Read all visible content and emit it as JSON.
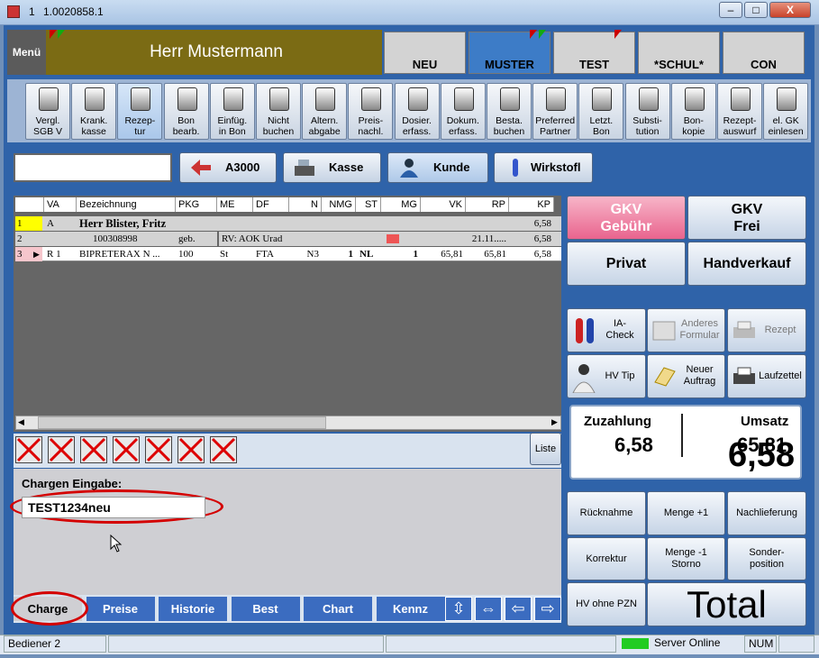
{
  "window": {
    "title_number": "1",
    "title": "1.0020858.1",
    "min": "–",
    "max": "□",
    "close": "X"
  },
  "header": {
    "menu": "Menü",
    "customer": "Herr Mustermann"
  },
  "customer_tabs": [
    "NEU",
    "MUSTER",
    "TEST",
    "*SCHUL*",
    "CON"
  ],
  "toolbar": [
    {
      "l1": "Vergl.",
      "l2": "SGB V"
    },
    {
      "l1": "Krank.",
      "l2": "kasse"
    },
    {
      "l1": "Rezep-",
      "l2": "tur"
    },
    {
      "l1": "Bon",
      "l2": "bearb."
    },
    {
      "l1": "Einfüg.",
      "l2": "in Bon"
    },
    {
      "l1": "Nicht",
      "l2": "buchen"
    },
    {
      "l1": "Altern.",
      "l2": "abgabe"
    },
    {
      "l1": "Preis-",
      "l2": "nachl."
    },
    {
      "l1": "Dosier.",
      "l2": "erfass."
    },
    {
      "l1": "Dokum.",
      "l2": "erfass."
    },
    {
      "l1": "Besta.",
      "l2": "buchen"
    },
    {
      "l1": "Preferred",
      "l2": "Partner"
    },
    {
      "l1": "Letzt.",
      "l2": "Bon"
    },
    {
      "l1": "Substi-",
      "l2": "tution"
    },
    {
      "l1": "Bon-",
      "l2": "kopie"
    },
    {
      "l1": "Rezept-",
      "l2": "auswurf"
    },
    {
      "l1": "el. GK",
      "l2": "einlesen"
    }
  ],
  "search": {
    "value": "",
    "a3000": "A3000",
    "kasse": "Kasse",
    "kunde": "Kunde",
    "wirkstoff": "Wirkstofl"
  },
  "table": {
    "headers": [
      "VA",
      "Bezeichnung",
      "PKG",
      "ME",
      "DF",
      "N",
      "NMG",
      "ST",
      "MG",
      "VK",
      "RP",
      "KP"
    ],
    "rows": [
      {
        "num": "1",
        "va": "A",
        "bez": "Herr  Blister, Fritz",
        "pkg": "",
        "me": "",
        "df": "",
        "n": "",
        "nmg": "",
        "st": "",
        "mg": "",
        "vk": "",
        "rp": "",
        "kp": "6,58"
      },
      {
        "num": "2",
        "va": "",
        "bez": "100308998",
        "pkg": "geb.",
        "me": "RV: AOK Urad",
        "df": "",
        "n": "",
        "nmg": "",
        "st": "",
        "mg": "",
        "vk": "",
        "rp": "21.11.....",
        "kp": "6,58"
      },
      {
        "num": "3",
        "va": "R 1",
        "bez": "BIPRETERAX N ...",
        "pkg": "100",
        "me": "St",
        "df": "FTA",
        "n": "N3",
        "nmg": "1",
        "st": "NL",
        "mg": "1",
        "vk": "65,81",
        "rp": "65,81",
        "kp": "6,58"
      }
    ]
  },
  "liste": "Liste",
  "chargen": {
    "label": "Chargen Eingabe:",
    "value": "TEST1234neu"
  },
  "bottom_tabs": [
    "Charge",
    "Preise",
    "Historie",
    "Best",
    "Chart",
    "Kennz"
  ],
  "right": {
    "gkv_gebuehr": [
      "GKV",
      "Gebühr"
    ],
    "gkv_frei": [
      "GKV",
      "Frei"
    ],
    "privat": "Privat",
    "handverkauf": "Handverkauf",
    "ia_check": [
      "IA-",
      "Check"
    ],
    "anderes_formular": [
      "Anderes",
      "Formular"
    ],
    "rezept": "Rezept",
    "hv_tip": "HV Tip",
    "neuer_auftrag": [
      "Neuer",
      "Auftrag"
    ],
    "laufzettel": "Laufzettel",
    "zuzahlung_label": "Zuzahlung",
    "zuzahlung": "6,58",
    "umsatz_label": "Umsatz",
    "umsatz_old": "65,81",
    "umsatz": "6,58",
    "ruecknahme": "Rücknahme",
    "menge_plus": "Menge +1",
    "nachlieferung": "Nachlieferung",
    "korrektur": "Korrektur",
    "menge_minus": [
      "Menge -1",
      "Storno"
    ],
    "sonderposition": [
      "Sonder-",
      "position"
    ],
    "hv_ohne_pzn": "HV ohne PZN",
    "total": "Total"
  },
  "status": {
    "bediener": "Bediener 2",
    "server": "Server Online",
    "num": "NUM"
  },
  "colors": {
    "accent": "#2f63a9",
    "header": "#7b6b14",
    "gkv_gebuehr": "#e9648e",
    "online": "#22cc22"
  }
}
